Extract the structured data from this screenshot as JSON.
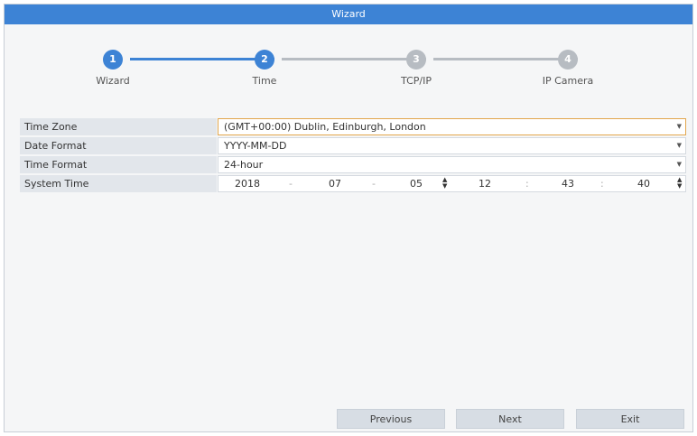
{
  "window": {
    "title": "Wizard"
  },
  "steps": [
    {
      "number": "1",
      "label": "Wizard",
      "state": "done"
    },
    {
      "number": "2",
      "label": "Time",
      "state": "current"
    },
    {
      "number": "3",
      "label": "TCP/IP",
      "state": "pending"
    },
    {
      "number": "4",
      "label": "IP Camera",
      "state": "pending"
    }
  ],
  "form": {
    "time_zone": {
      "label": "Time Zone",
      "value": "(GMT+00:00) Dublin, Edinburgh, London"
    },
    "date_format": {
      "label": "Date Format",
      "value": "YYYY-MM-DD"
    },
    "time_format": {
      "label": "Time Format",
      "value": "24-hour"
    },
    "system_time": {
      "label": "System Time",
      "year": "2018",
      "month": "07",
      "day": "05",
      "hour": "12",
      "minute": "43",
      "second": "40",
      "date_separator": "-",
      "time_separator": ":"
    }
  },
  "buttons": {
    "previous": "Previous",
    "next": "Next",
    "exit": "Exit"
  },
  "colors": {
    "accent": "#3d83d5",
    "pending": "#b7bcc2",
    "focus_border": "#e2a64c"
  }
}
